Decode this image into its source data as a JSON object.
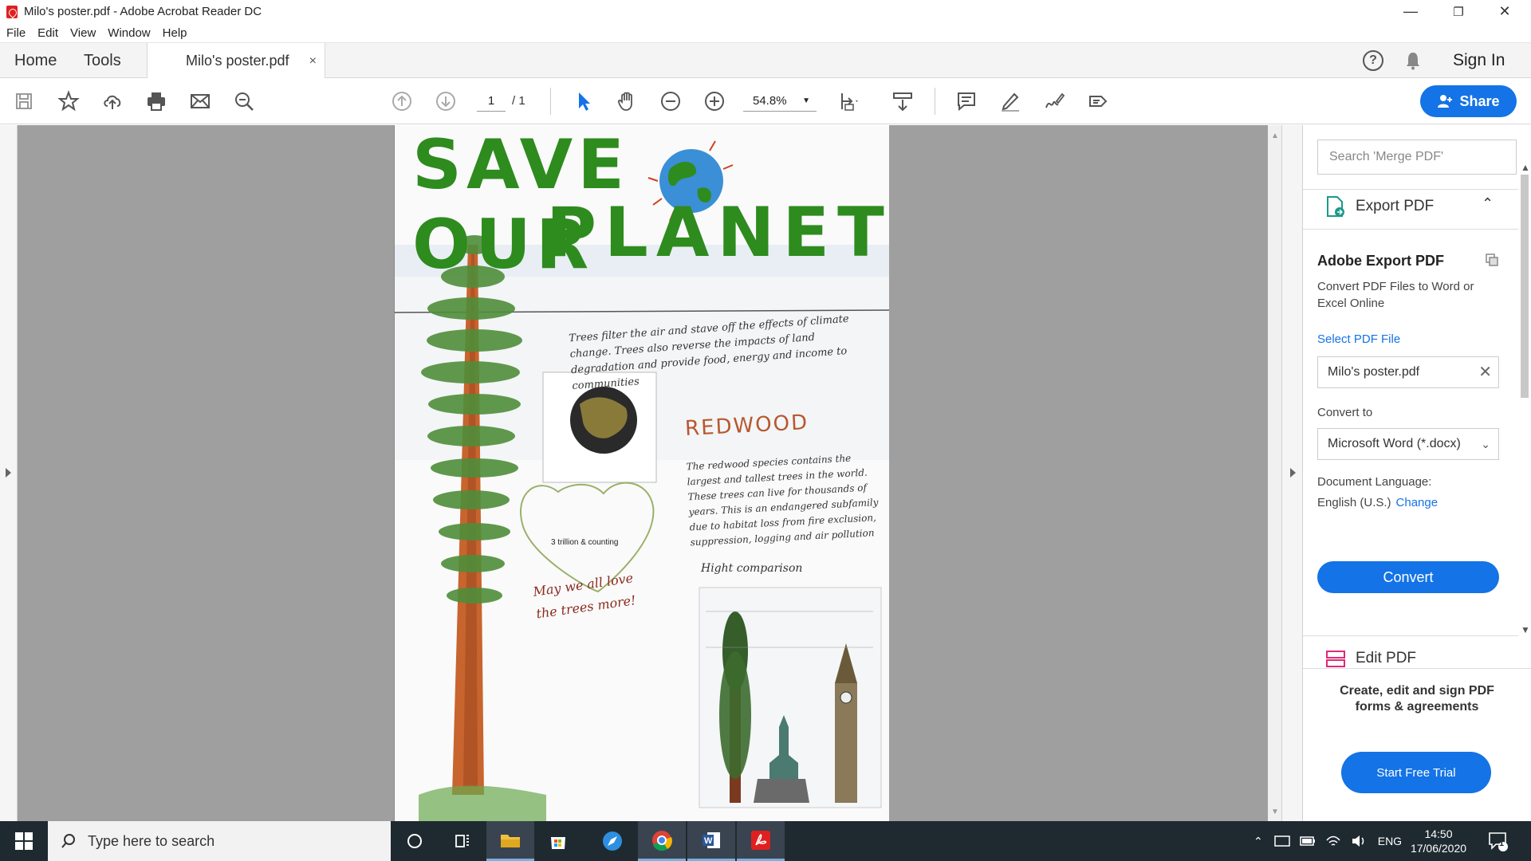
{
  "window": {
    "title": "Milo's poster.pdf - Adobe Acrobat Reader DC",
    "minimize": "—",
    "restore": "❐",
    "close": "✕"
  },
  "menu": [
    "File",
    "Edit",
    "View",
    "Window",
    "Help"
  ],
  "tabs": {
    "home": "Home",
    "tools": "Tools",
    "document": "Milo's poster.pdf",
    "close": "×"
  },
  "header": {
    "help": "?",
    "signin": "Sign In"
  },
  "toolbar": {
    "page_current": "1",
    "page_total": "/ 1",
    "zoom": "54.8%",
    "share_label": "Share"
  },
  "poster": {
    "title_line1": "SAVE OUR",
    "title_line2": "PLANET",
    "intro_text": "Trees filter the air and stave off the effects of climate change. Trees also reverse the impacts of land degradation and provide food, energy and income to communities",
    "redwood_heading": "REDWOOD",
    "redwood_text": "The redwood species contains the largest and tallest trees in the world. These trees can live for thousands of years. This is an endangered subfamily due to habitat loss from fire exclusion, suppression, logging and air pollution",
    "globe_caption": "3 trillion & counting",
    "heart_text": "May we all love the trees more!",
    "height_heading": "Hight comparison"
  },
  "right_panel": {
    "search_placeholder": "Search 'Merge PDF'",
    "export_header": "Export PDF",
    "export_chevron": "⌃",
    "title": "Adobe Export PDF",
    "description": "Convert PDF Files to Word or Excel Online",
    "select_file_link": "Select PDF File",
    "file_name": "Milo's poster.pdf",
    "file_clear": "✕",
    "convert_to_label": "Convert to",
    "convert_to_value": "Microsoft Word (*.docx)",
    "doc_language_label": "Document Language:",
    "doc_language_value": "English (U.S.)",
    "change_link": "Change",
    "convert_button": "Convert",
    "edit_pdf": "Edit PDF",
    "promo_line1": "Create, edit and sign PDF",
    "promo_line2": "forms & agreements",
    "trial_button": "Start Free Trial"
  },
  "taskbar": {
    "search_placeholder": "Type here to search",
    "language": "ENG",
    "time": "14:50",
    "date": "17/06/2020",
    "notifications": "1"
  },
  "colors": {
    "accent": "#1473e6",
    "taskbar": "#1f2a30",
    "poster_green": "#2e8b1e",
    "acrobat_red": "#e02020"
  }
}
